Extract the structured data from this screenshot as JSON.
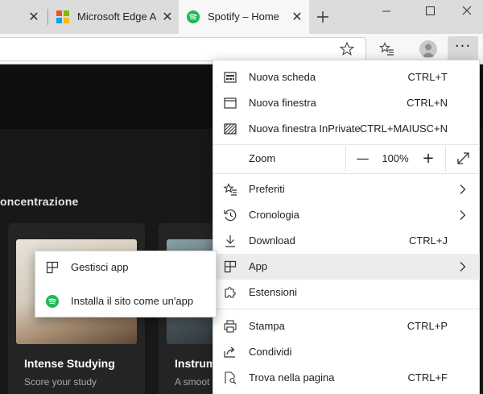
{
  "tabs": [
    {
      "title": "",
      "close": "✕"
    },
    {
      "title": "Microsoft Edge Ac",
      "close": "✕"
    },
    {
      "title": "Spotify – Home",
      "close": "✕"
    }
  ],
  "page": {
    "section_title": "oncentrazione",
    "cards": [
      {
        "title": "Intense Studying",
        "subtitle": "Score your study"
      },
      {
        "title": "Instrum",
        "subtitle": "A smoot"
      }
    ]
  },
  "toolbar": {
    "more_label": "···"
  },
  "menu": {
    "items": [
      {
        "label": "Nuova scheda",
        "shortcut": "CTRL+T"
      },
      {
        "label": "Nuova finestra",
        "shortcut": "CTRL+N"
      },
      {
        "label": "Nuova finestra InPrivate",
        "shortcut": "CTRL+MAIUSC+N"
      },
      {
        "label": "Zoom",
        "shortcut": ""
      },
      {
        "label": "Preferiti",
        "shortcut": ""
      },
      {
        "label": "Cronologia",
        "shortcut": ""
      },
      {
        "label": "Download",
        "shortcut": "CTRL+J"
      },
      {
        "label": "App",
        "shortcut": ""
      },
      {
        "label": "Estensioni",
        "shortcut": ""
      },
      {
        "label": "Stampa",
        "shortcut": "CTRL+P"
      },
      {
        "label": "Condividi",
        "shortcut": ""
      },
      {
        "label": "Trova nella pagina",
        "shortcut": "CTRL+F"
      }
    ],
    "zoom": {
      "minus": "—",
      "value": "100%",
      "plus": "+"
    }
  },
  "submenu": {
    "items": [
      {
        "label": "Gestisci app"
      },
      {
        "label": "Installa il sito come un'app"
      }
    ]
  },
  "colors": {
    "spotify_green": "#1db954",
    "menu_highlight": "#ececec",
    "page_bg": "#181818"
  }
}
